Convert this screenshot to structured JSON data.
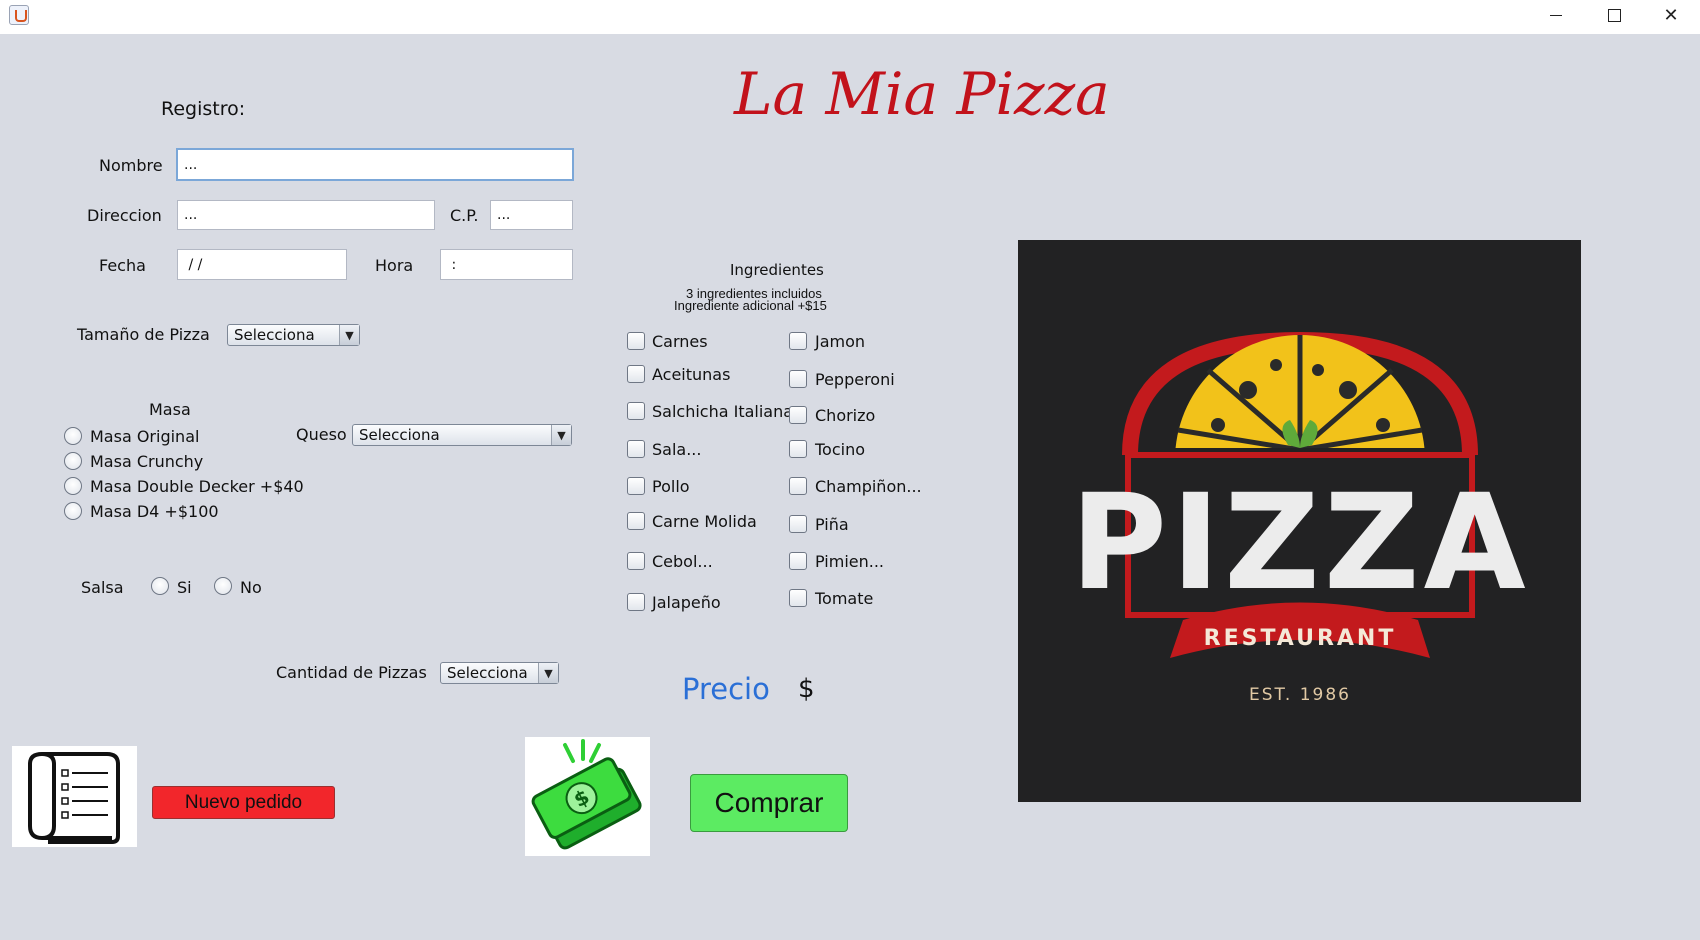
{
  "window": {
    "minimize_icon": "minimize-icon",
    "maximize_icon": "maximize-icon",
    "close_symbol": "✕"
  },
  "brand_title": "La Mia Pizza",
  "registro": {
    "heading": "Registro:",
    "nombre_label": "Nombre",
    "nombre_value": "...",
    "direccion_label": "Direccion",
    "direccion_value": "...",
    "cp_label": "C.P.",
    "cp_value": "...",
    "fecha_label": "Fecha",
    "fecha_value": " / /",
    "hora_label": "Hora",
    "hora_value": " :"
  },
  "tamano": {
    "label": "Tamaño de Pizza",
    "selected": "Selecciona"
  },
  "masa": {
    "heading": "Masa",
    "options": [
      "Masa Original",
      "Masa Crunchy",
      "Masa Double Decker +$40",
      "Masa D4 +$100"
    ]
  },
  "queso": {
    "label": "Queso",
    "selected": "Selecciona"
  },
  "salsa": {
    "label": "Salsa",
    "si": "Si",
    "no": "No"
  },
  "cantidad": {
    "label": "Cantidad de Pizzas",
    "selected": "Selecciona"
  },
  "ingredientes": {
    "heading": "Ingredientes",
    "note1": "3 ingredientes incluidos",
    "note2": "Ingrediente adicional +$15",
    "col1": [
      "Carnes",
      "Aceitunas",
      "Salchicha Italiana",
      "Sala...",
      "Pollo",
      "Carne Molida",
      "Cebol...",
      "Jalapeño"
    ],
    "col2": [
      "Jamon",
      "Pepperoni",
      "Chorizo",
      "Tocino",
      "Champiñon...",
      "Piña",
      "Pimien...",
      "Tomate"
    ]
  },
  "precio": {
    "label": "Precio",
    "symbol": "$"
  },
  "buttons": {
    "nuevo_pedido": "Nuevo pedido",
    "comprar": "Comprar"
  },
  "logo": {
    "word": "PIZZA",
    "ribbon": "RESTAURANT",
    "est": "EST. 1986"
  },
  "colors": {
    "brand_red": "#c2121b",
    "precio_blue": "#2a6fd6",
    "nuevo_red": "#f2262b",
    "comprar_green": "#5ceb62"
  }
}
